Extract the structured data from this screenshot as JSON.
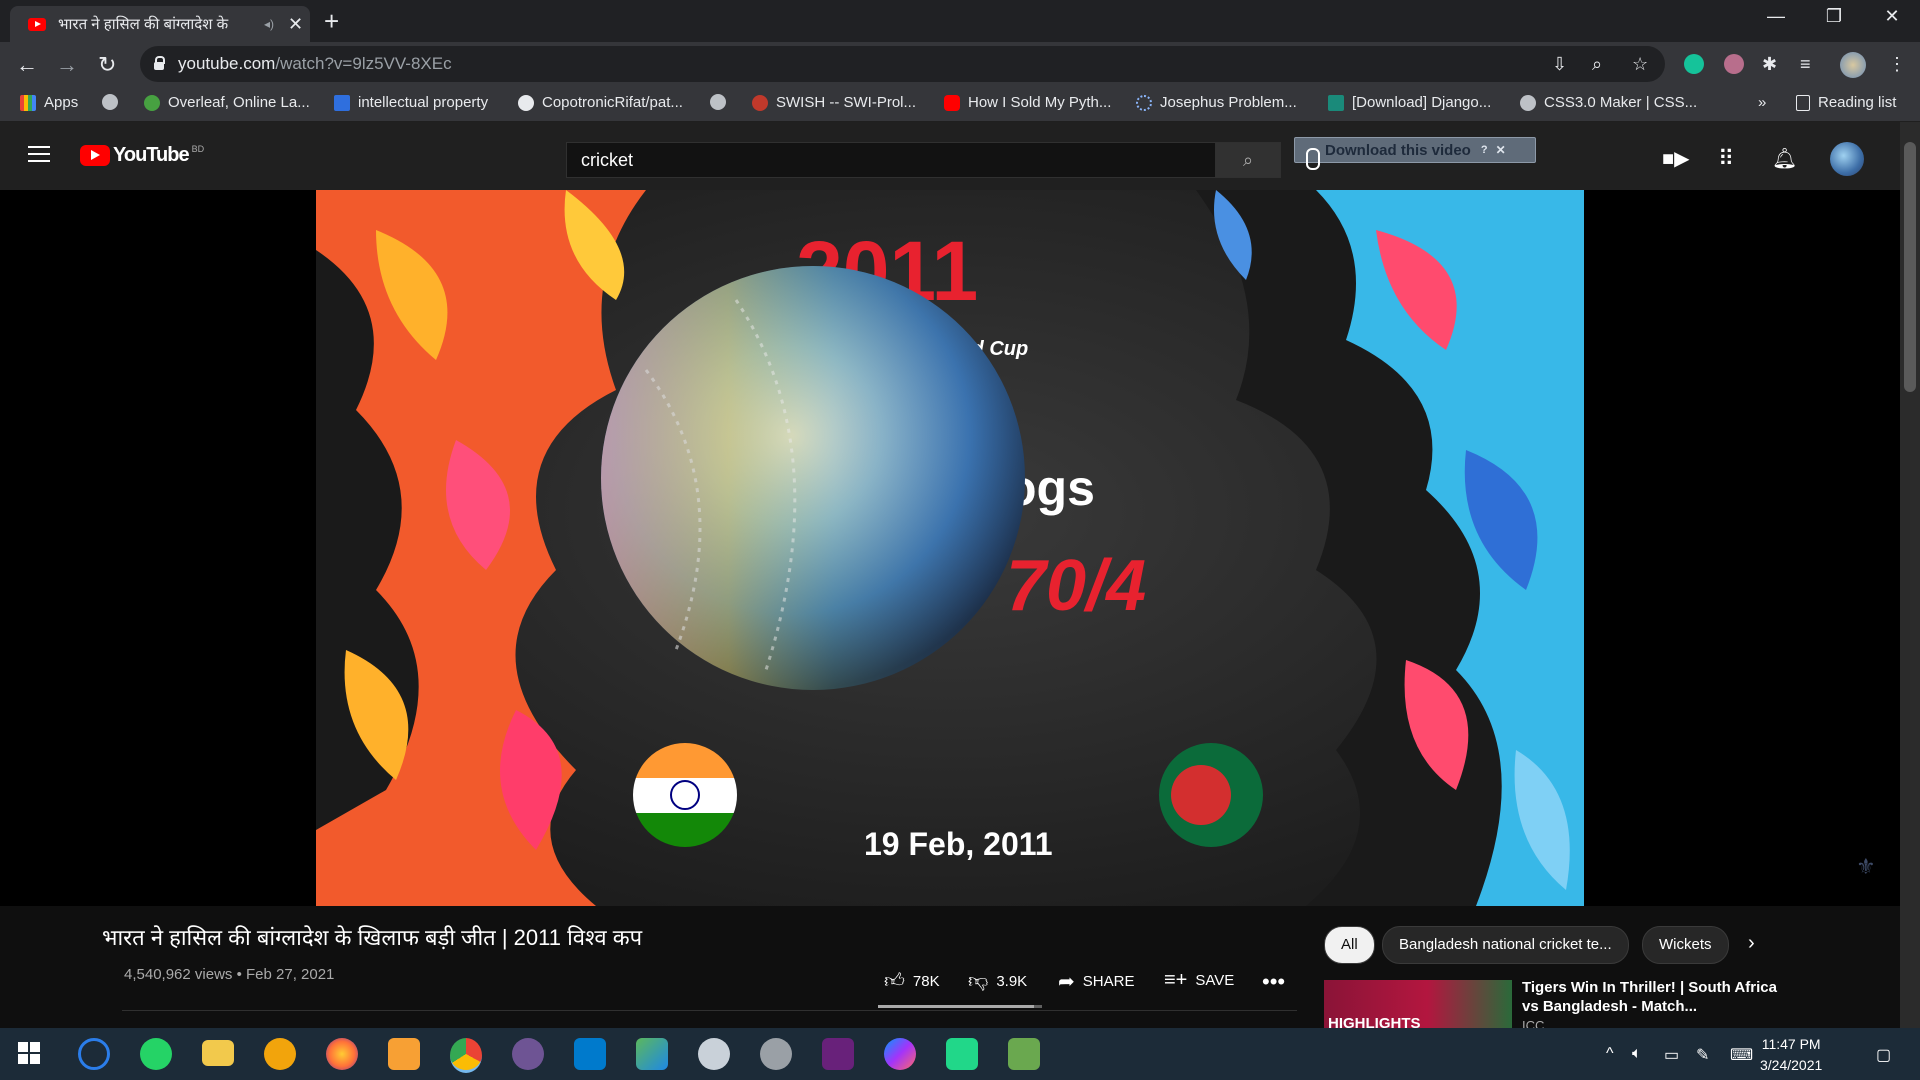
{
  "browser": {
    "tab_title": "भारत ने हासिल की बांग्लादेश के",
    "tab_close": "✕",
    "new_tab": "+",
    "window": {
      "minimize": "—",
      "restore": "❐",
      "close": "✕"
    },
    "url_host": "youtube.com",
    "url_path": "/watch?v=9lz5VV-8XEc"
  },
  "bookmarks": [
    {
      "label": "Apps"
    },
    {
      "label": ""
    },
    {
      "label": "Overleaf, Online La..."
    },
    {
      "label": "intellectual property"
    },
    {
      "label": "CopotronicRifat/pat..."
    },
    {
      "label": ""
    },
    {
      "label": "SWISH -- SWI-Prol..."
    },
    {
      "label": "How I Sold My Pyth..."
    },
    {
      "label": "Josephus Problem..."
    },
    {
      "label": "[Download] Django..."
    },
    {
      "label": "CSS3.0 Maker | CSS..."
    }
  ],
  "bookmarks_more": "»",
  "reading_list": "Reading list",
  "youtube": {
    "logo_text": "YouTube",
    "country_code": "BD",
    "search_value": "cricket",
    "download_label": "Download this video",
    "download_help": "?",
    "download_close": "✕"
  },
  "video": {
    "title": "भारत ने हासिल की बांग्लादेश के खिलाफ बड़ी जीत | 2011 विश्व कप",
    "views": "4,540,962 views",
    "date": "Feb 27, 2021",
    "frame_text": {
      "year": "2011",
      "cup": "ld Cup",
      "innings": "ogs",
      "score": "70/4",
      "date": "19 Feb, 2011"
    },
    "likes": "78K",
    "dislikes": "3.9K",
    "share": "SHARE",
    "save": "SAVE",
    "like_ratio": 0.95
  },
  "chips": [
    {
      "label": "All",
      "selected": true
    },
    {
      "label": "Bangladesh national cricket te..."
    },
    {
      "label": "Wickets"
    }
  ],
  "recommendation": {
    "title": "Tigers Win In Thriller! | South Africa vs Bangladesh - Match...",
    "channel": "ICC",
    "thumb_label": "HIGHLIGHTS"
  },
  "taskbar": {
    "time": "11:47 PM",
    "date": "3/24/2021"
  },
  "colors": {
    "youtube_red": "#ff0000",
    "chrome_dark": "#202124",
    "taskbar": "#1c2b38"
  }
}
